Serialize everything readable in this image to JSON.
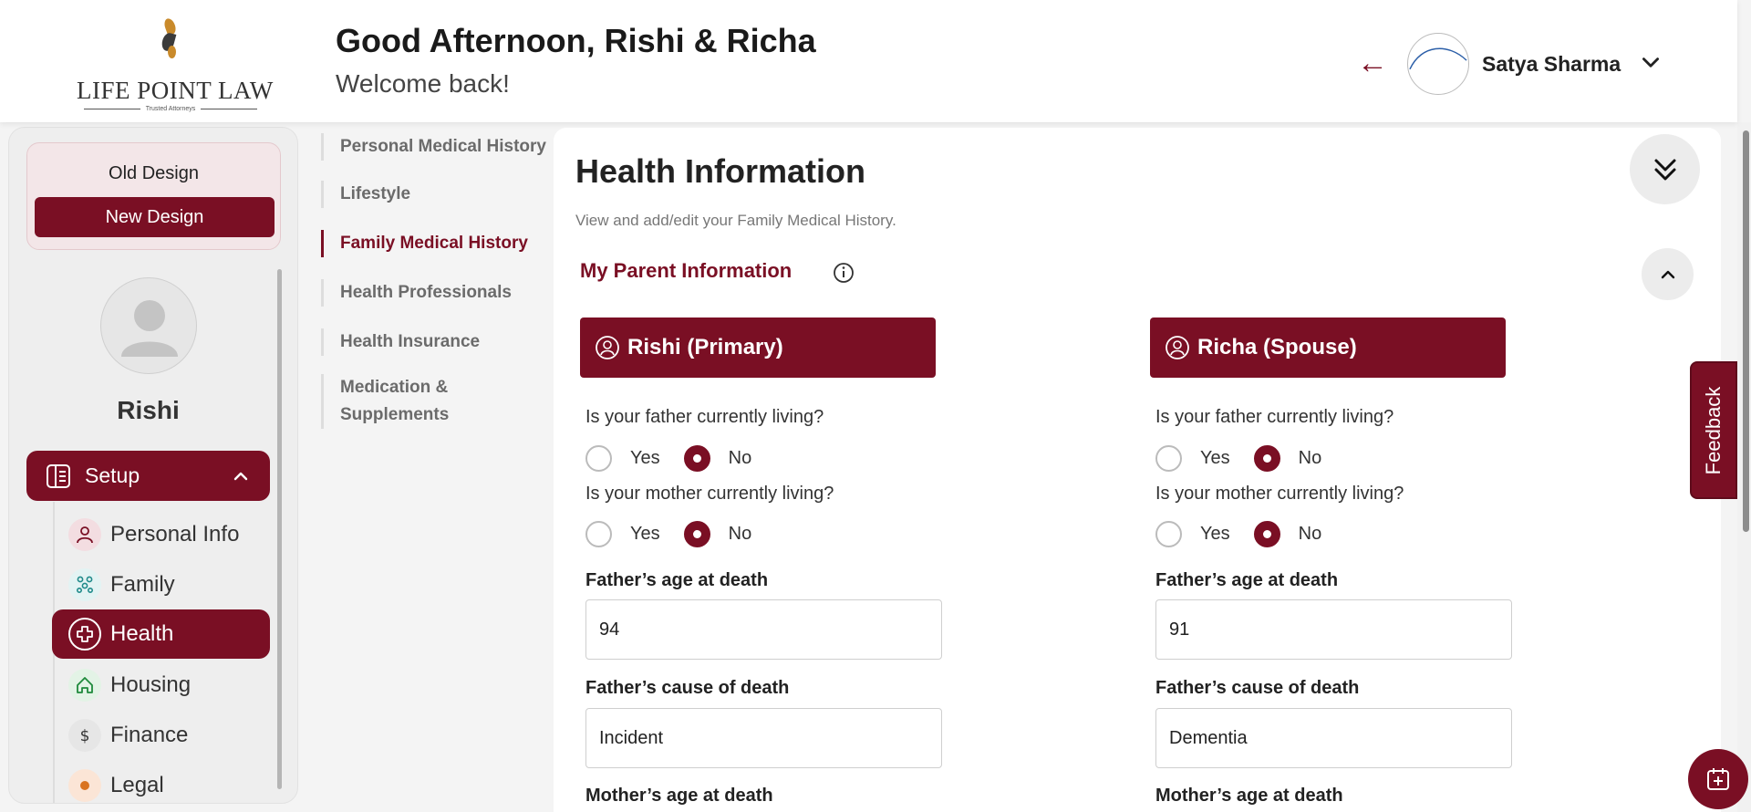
{
  "brand": {
    "name": "LIFE POINT LAW",
    "tagline": "Trusted Attorneys"
  },
  "header": {
    "greeting": "Good Afternoon, Rishi & Richa",
    "subgreeting": "Welcome back!",
    "user_name": "Satya Sharma"
  },
  "sidebar": {
    "old_design_label": "Old Design",
    "new_design_label": "New Design",
    "profile_name": "Rishi",
    "setup_label": "Setup",
    "items": [
      {
        "label": "Personal Info",
        "icon": "user-icon"
      },
      {
        "label": "Family",
        "icon": "family-icon"
      },
      {
        "label": "Health",
        "icon": "health-plus-icon",
        "active": true
      },
      {
        "label": "Housing",
        "icon": "home-icon"
      },
      {
        "label": "Finance",
        "icon": "dollar-icon"
      },
      {
        "label": "Legal",
        "icon": "legal-icon"
      }
    ]
  },
  "subnav": {
    "items": [
      {
        "label": "Personal Medical History"
      },
      {
        "label": "Lifestyle"
      },
      {
        "label": "Family Medical History",
        "active": true
      },
      {
        "label": "Health Professionals"
      },
      {
        "label": "Health Insurance"
      },
      {
        "label": "Medication &"
      },
      {
        "label": "Supplements"
      }
    ]
  },
  "main": {
    "title": "Health Information",
    "subtitle": "View and add/edit your Family Medical History.",
    "section_title": "My Parent Information",
    "columns": [
      {
        "header": "Rishi (Primary)",
        "father_living_q": "Is your father currently living?",
        "father_living": "No",
        "mother_living_q": "Is your mother currently living?",
        "mother_living": "No",
        "yes_label": "Yes",
        "no_label": "No",
        "father_age_label": "Father’s age at death",
        "father_age_value": "94",
        "father_cause_label": "Father’s cause of death",
        "father_cause_value": "Incident",
        "mother_age_label": "Mother’s age at death"
      },
      {
        "header": "Richa (Spouse)",
        "father_living_q": "Is your father currently living?",
        "father_living": "No",
        "mother_living_q": "Is your mother currently living?",
        "mother_living": "No",
        "yes_label": "Yes",
        "no_label": "No",
        "father_age_label": "Father’s age at death",
        "father_age_value": "91",
        "father_cause_label": "Father’s cause of death",
        "father_cause_value": "Dementia",
        "mother_age_label": "Mother’s age at death"
      }
    ]
  },
  "feedback_label": "Feedback",
  "colors": {
    "brand": "#7a0f24",
    "muted": "#6b6b6b",
    "panel": "#ffffff",
    "background": "#f4f4f4"
  }
}
